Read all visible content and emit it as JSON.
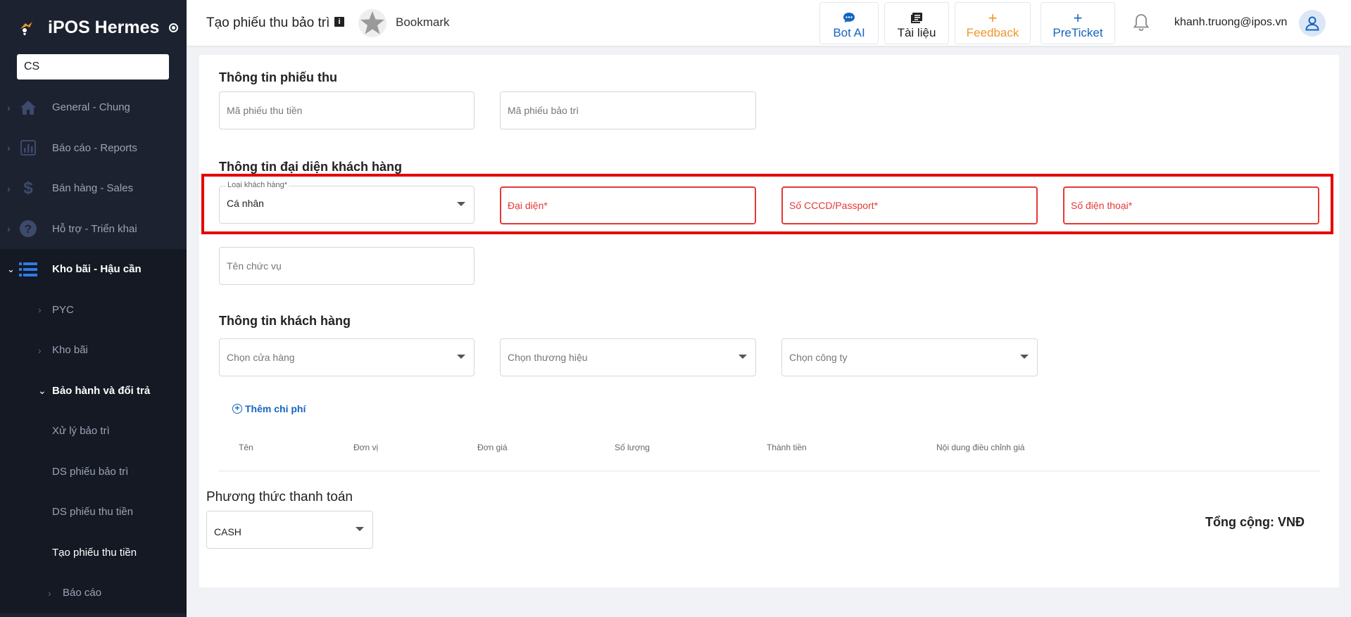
{
  "app": {
    "name": "iPOS Hermes"
  },
  "sidebar": {
    "search_value": "CS",
    "items": [
      {
        "label": "General - Chung"
      },
      {
        "label": "Báo cáo - Reports"
      },
      {
        "label": "Bán hàng - Sales"
      },
      {
        "label": "Hỗ trợ - Triển khai"
      },
      {
        "label": "Kho bãi - Hậu cần"
      },
      {
        "label": "PYC"
      },
      {
        "label": "Kho bãi"
      },
      {
        "label": "Bảo hành và đổi trả"
      },
      {
        "label": "Xử lý bảo trì"
      },
      {
        "label": "DS phiếu bảo trì"
      },
      {
        "label": "DS phiếu thu tiền"
      },
      {
        "label": "Tạo phiếu thu tiền"
      },
      {
        "label": "Báo cáo"
      }
    ]
  },
  "header": {
    "title": "Tạo phiếu thu bảo trì",
    "bookmark": "Bookmark",
    "buttons": {
      "bot_ai": "Bot AI",
      "tai_lieu": "Tài liệu",
      "feedback": "Feedback",
      "preticket": "PreTicket"
    },
    "user_email": "khanh.truong@ipos.vn"
  },
  "form": {
    "section_receipt": "Thông tin phiếu thu",
    "receipt_code_ph": "Mã phiếu thu tiền",
    "maintenance_code_ph": "Mã phiếu bảo trì",
    "section_rep": "Thông tin đại diện khách hàng",
    "customer_type_label": "Loại khách hàng*",
    "customer_type_value": "Cá nhân",
    "representative_ph": "Đại diện*",
    "id_ph": "Số CCCD/Passport*",
    "phone_ph": "Số điện thoại*",
    "position_ph": "Tên chức vụ",
    "section_customer": "Thông tin khách hàng",
    "store_ph": "Chọn cửa hàng",
    "brand_ph": "Chọn thương hiệu",
    "company_ph": "Chọn công ty",
    "add_cost": "Thêm chi phí",
    "table_headers": [
      "Tên",
      "Đơn vị",
      "Đơn giá",
      "Số lượng",
      "Thành tiền",
      "Nội dung điều chỉnh giá"
    ],
    "section_payment": "Phương thức thanh toán",
    "payment_value": "CASH",
    "total": "Tổng cộng: VNĐ"
  },
  "colors": {
    "sidebar_bg": "#1c2230",
    "accent_blue": "#1565c0",
    "feedback_orange": "#f0962b",
    "error_red": "#e53935",
    "highlight_red": "#e60000"
  }
}
